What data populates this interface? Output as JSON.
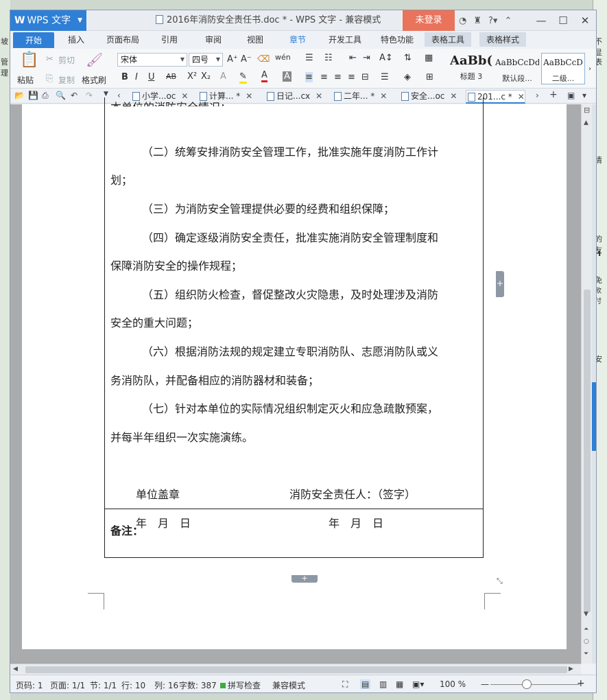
{
  "desktop_right": [
    "不显",
    "表",
    "清",
    "的友",
    "H",
    "免",
    "款付",
    "安"
  ],
  "desktop_left": [
    "坡",
    "管理"
  ],
  "titlebar": {
    "app_name": "WPS 文字",
    "document_title": "2016年消防安全责任书.doc * - WPS 文字 - 兼容模式",
    "login_label": "未登录",
    "help_label": "?"
  },
  "menubar": {
    "items": [
      "开始",
      "插入",
      "页面布局",
      "引用",
      "审阅",
      "视图",
      "章节",
      "开发工具",
      "特色功能",
      "表格工具",
      "表格样式"
    ],
    "active": "开始"
  },
  "ribbon": {
    "cut": "剪切",
    "copy": "复制",
    "paste": "粘贴",
    "format_painter": "格式刷",
    "font_name": "宋体",
    "font_size": "四号",
    "styles": [
      {
        "preview": "AaBb(",
        "label": "标题 3"
      },
      {
        "preview": "AaBbCcDd",
        "label": "默认段..."
      },
      {
        "preview": "AaBbCcD",
        "label": "二级..."
      }
    ]
  },
  "doc_tabs": [
    {
      "label": "小学...oc",
      "active": false
    },
    {
      "label": "计算... *",
      "active": false
    },
    {
      "label": "日记...cx",
      "active": false
    },
    {
      "label": "二年... *",
      "active": false
    },
    {
      "label": "安全...oc",
      "active": false
    },
    {
      "label": "201...c *",
      "active": true
    }
  ],
  "document": {
    "top_cut_line": "本单位的消防安全情况；",
    "lines": [
      "（二）统筹安排消防安全管理工作，批准实施年度消防工作计",
      "划；",
      "（三）为消防安全管理提供必要的经费和组织保障；",
      "（四）确定逐级消防安全责任，批准实施消防安全管理制度和",
      "保障消防安全的操作规程；",
      "（五）组织防火检查，督促整改火灾隐患，及时处理涉及消防",
      "安全的重大问题；",
      "（六）根据消防法规的规定建立专职消防队、志愿消防队或义",
      "务消防队，并配备相应的消防器材和装备；",
      "（七）针对本单位的实际情况组织制定灭火和应急疏散预案，",
      "并每半年组织一次实施演练。"
    ],
    "seal_label": "单位盖章",
    "signer_label": "消防安全责任人：（签字）",
    "date_left": "年　月　日",
    "date_right": "年　月　日",
    "note_label": "备注："
  },
  "statusbar": {
    "page_no": "页码: 1",
    "pages": "页面: 1/1",
    "section": "节: 1/1",
    "row": "行: 10",
    "col": "列: 16",
    "words": "字数: 387",
    "spell": "拼写检查",
    "mode": "兼容模式",
    "zoom": "100 %"
  }
}
